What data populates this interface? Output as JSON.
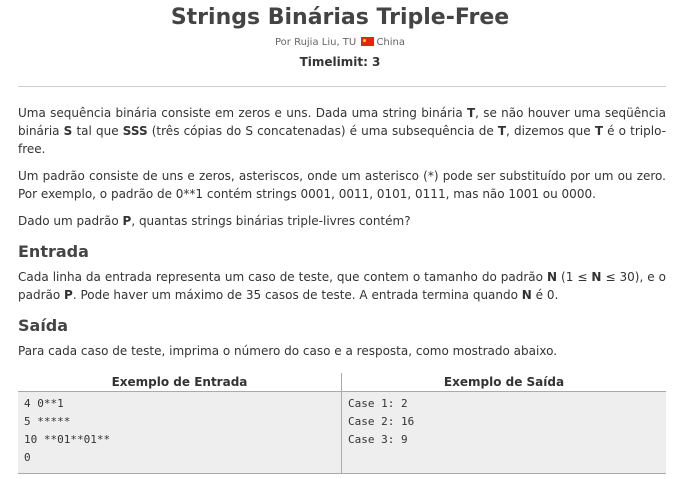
{
  "header": {
    "title": "Strings Binárias Triple-Free",
    "author_prefix": "Por Rujia Liu, TU",
    "country": "China",
    "timelimit_label": "Timelimit: 3"
  },
  "statement": {
    "p1": {
      "t1": "Uma sequência binária consiste em zeros e uns. Dada uma string binária ",
      "b1": "T",
      "t2": ", se não houver uma seqüência binária ",
      "b2": "S",
      "t3": " tal que ",
      "b3": "SSS",
      "t4": " (três cópias do S concatenadas) é uma subsequência de ",
      "b4": "T",
      "t5": ", dizemos que ",
      "b5": "T",
      "t6": " é o triplo-free."
    },
    "p2": "Um padrão consiste de uns e zeros, asteriscos, onde um asterisco (*) pode ser substituído por um ou zero. Por exemplo, o padrão de 0**1 contém strings 0001, 0011, 0101, 0111, mas não 1001 ou 0000.",
    "p3": {
      "t1": "Dado um padrão ",
      "b1": "P",
      "t2": ", quantas strings binárias triple-livres contém?"
    }
  },
  "input_section": {
    "heading": "Entrada",
    "t1": "Cada linha da entrada representa um caso de teste, que contem o tamanho do padrão ",
    "b1": "N",
    "t2": " (1 ≤ ",
    "b2": "N",
    "t3": " ≤ 30), e o padrão ",
    "b3": "P",
    "t4": ". Pode haver um máximo de 35 casos de teste. A entrada termina quando ",
    "b4": "N",
    "t5": " é 0."
  },
  "output_section": {
    "heading": "Saída",
    "text": "Para cada caso de teste, imprima o número do caso e a resposta, como mostrado abaixo."
  },
  "examples": {
    "input_header": "Exemplo de Entrada",
    "output_header": "Exemplo de Saída",
    "input_text": "4 0**1\n5 *****\n10 **01**01**\n0",
    "output_text": "Case 1: 2\nCase 2: 16\nCase 3: 9"
  },
  "colors": {
    "flag_red": "#de2910",
    "flag_yellow": "#ffde00",
    "example_bg": "#eeeeee"
  }
}
